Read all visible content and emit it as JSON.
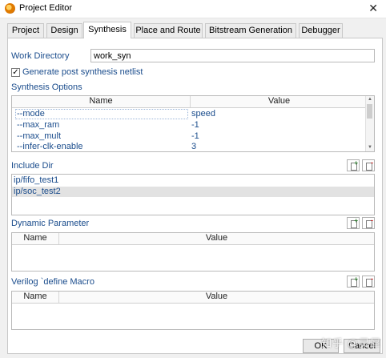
{
  "window": {
    "title": "Project Editor"
  },
  "tabs": [
    {
      "label": "Project"
    },
    {
      "label": "Design"
    },
    {
      "label": "Synthesis"
    },
    {
      "label": "Place and Route"
    },
    {
      "label": "Bitstream Generation"
    },
    {
      "label": "Debugger"
    }
  ],
  "active_tab": "Synthesis",
  "work_directory": {
    "label": "Work Directory",
    "value": "work_syn"
  },
  "generate_netlist": {
    "label": "Generate post synthesis netlist",
    "checked": true,
    "mark": "✓"
  },
  "synthesis_options": {
    "label": "Synthesis Options",
    "columns": [
      "Name",
      "Value"
    ],
    "rows": [
      {
        "name": "--mode",
        "value": "speed"
      },
      {
        "name": "--max_ram",
        "value": "-1"
      },
      {
        "name": "--max_mult",
        "value": "-1"
      },
      {
        "name": "--infer-clk-enable",
        "value": "3"
      }
    ]
  },
  "include_dir": {
    "label": "Include Dir",
    "items": [
      "ip/fifo_test1",
      "ip/soc_test2"
    ],
    "selected_index": 1
  },
  "dynamic_parameter": {
    "label": "Dynamic Parameter",
    "columns": [
      "Name",
      "Value"
    ]
  },
  "verilog_define": {
    "label": "Verilog `define Macro",
    "columns": [
      "Name",
      "Value"
    ]
  },
  "buttons": {
    "ok": "OK",
    "cancel": "Cancel"
  },
  "watermark": "知乎 @灵犀"
}
